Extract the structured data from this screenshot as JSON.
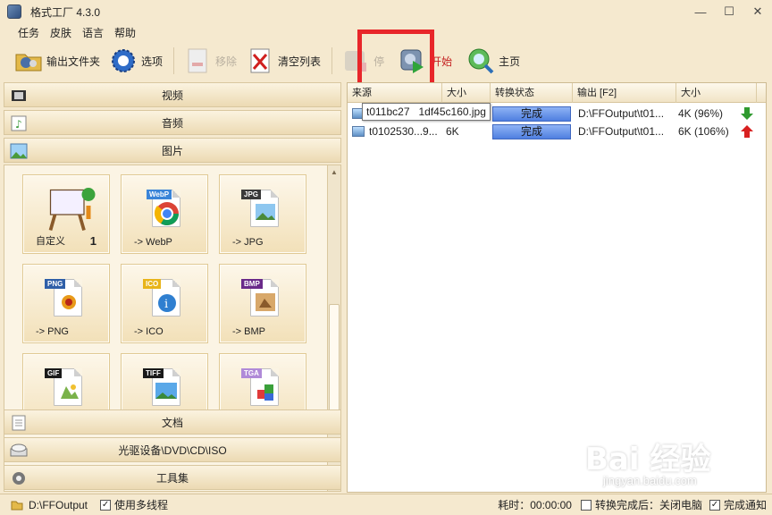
{
  "window": {
    "title": "格式工厂 4.3.0",
    "minimize": "—",
    "maximize": "☐",
    "close": "✕"
  },
  "menu": [
    "任务",
    "皮肤",
    "语言",
    "帮助"
  ],
  "toolbar": {
    "output_folder": "输出文件夹",
    "options": "选项",
    "remove": "移除",
    "clear_list": "清空列表",
    "stop": "停",
    "start": "开始",
    "home": "主页"
  },
  "categories": {
    "video": "视频",
    "audio": "音频",
    "image": "图片",
    "document": "文档",
    "disc": "光驱设备\\DVD\\CD\\ISO",
    "tools": "工具集"
  },
  "tiles": [
    {
      "label": "自定义",
      "count": "1"
    },
    {
      "label": "-> WebP",
      "tag": "WebP"
    },
    {
      "label": "-> JPG",
      "tag": "JPG"
    },
    {
      "label": "-> PNG",
      "tag": "PNG"
    },
    {
      "label": "-> ICO",
      "tag": "ICO"
    },
    {
      "label": "-> BMP",
      "tag": "BMP"
    },
    {
      "label": "",
      "tag": "GIF"
    },
    {
      "label": "",
      "tag": "TIFF"
    },
    {
      "label": "",
      "tag": "TGA"
    }
  ],
  "table": {
    "headers": [
      "来源",
      "大小",
      "转换状态",
      "输出 [F2]",
      "大小"
    ],
    "rows": [
      {
        "source": "t011bc27",
        "size": "",
        "status": "完成",
        "output": "D:\\FFOutput\\t01...",
        "out_size": "4K (96%)",
        "trend": "down"
      },
      {
        "source": "t0102530...9...",
        "size": "6K",
        "status": "完成",
        "output": "D:\\FFOutput\\t01...",
        "out_size": "6K (106%)",
        "trend": "up"
      }
    ],
    "tooltip": "t011bc27   1df45c160.jpg"
  },
  "statusbar": {
    "output_path": "D:\\FFOutput",
    "multithread": "使用多线程",
    "elapsed": "耗时：00:00:00",
    "after_done": "转换完成后：关闭电脑",
    "notify": "完成通知"
  },
  "watermark": {
    "logo": "Bai 经验",
    "url": "jingyan.baidu.com"
  },
  "colors": {
    "accent_red": "#e8262a",
    "status_blue": "#5a86e6",
    "panel_bg": "#f5e9cf"
  }
}
